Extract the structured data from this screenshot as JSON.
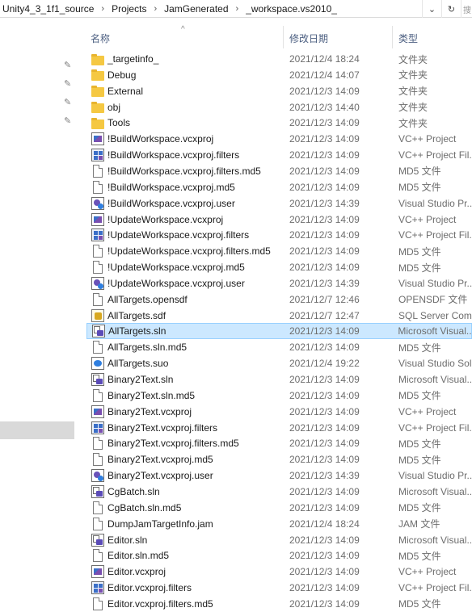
{
  "address": {
    "crumbs": [
      "Unity4_3_1f1_source",
      "Projects",
      "JamGenerated",
      "_workspace.vs2010_"
    ],
    "separator": "›",
    "dropdown_icon": "⌄",
    "refresh_icon": "↻",
    "search_hint": "搜"
  },
  "columns": {
    "name": "名称",
    "date": "修改日期",
    "type": "类型"
  },
  "files": [
    {
      "name": "_targetinfo_",
      "date": "2021/12/4 18:24",
      "type": "文件夹",
      "icon": "folder"
    },
    {
      "name": "Debug",
      "date": "2021/12/4 14:07",
      "type": "文件夹",
      "icon": "folder"
    },
    {
      "name": "External",
      "date": "2021/12/3 14:09",
      "type": "文件夹",
      "icon": "folder"
    },
    {
      "name": "obj",
      "date": "2021/12/3 14:40",
      "type": "文件夹",
      "icon": "folder"
    },
    {
      "name": "Tools",
      "date": "2021/12/3 14:09",
      "type": "文件夹",
      "icon": "folder"
    },
    {
      "name": "!BuildWorkspace.vcxproj",
      "date": "2021/12/3 14:09",
      "type": "VC++ Project",
      "icon": "vcx"
    },
    {
      "name": "!BuildWorkspace.vcxproj.filters",
      "date": "2021/12/3 14:09",
      "type": "VC++ Project Fil...",
      "icon": "vcxf"
    },
    {
      "name": "!BuildWorkspace.vcxproj.filters.md5",
      "date": "2021/12/3 14:09",
      "type": "MD5 文件",
      "icon": "doc"
    },
    {
      "name": "!BuildWorkspace.vcxproj.md5",
      "date": "2021/12/3 14:09",
      "type": "MD5 文件",
      "icon": "doc"
    },
    {
      "name": "!BuildWorkspace.vcxproj.user",
      "date": "2021/12/3 14:39",
      "type": "Visual Studio Pr...",
      "icon": "user"
    },
    {
      "name": "!UpdateWorkspace.vcxproj",
      "date": "2021/12/3 14:09",
      "type": "VC++ Project",
      "icon": "vcx"
    },
    {
      "name": "!UpdateWorkspace.vcxproj.filters",
      "date": "2021/12/3 14:09",
      "type": "VC++ Project Fil...",
      "icon": "vcxf"
    },
    {
      "name": "!UpdateWorkspace.vcxproj.filters.md5",
      "date": "2021/12/3 14:09",
      "type": "MD5 文件",
      "icon": "doc"
    },
    {
      "name": "!UpdateWorkspace.vcxproj.md5",
      "date": "2021/12/3 14:09",
      "type": "MD5 文件",
      "icon": "doc"
    },
    {
      "name": "!UpdateWorkspace.vcxproj.user",
      "date": "2021/12/3 14:39",
      "type": "Visual Studio Pr...",
      "icon": "user"
    },
    {
      "name": "AllTargets.opensdf",
      "date": "2021/12/7 12:46",
      "type": "OPENSDF 文件",
      "icon": "doc"
    },
    {
      "name": "AllTargets.sdf",
      "date": "2021/12/7 12:47",
      "type": "SQL Server Com...",
      "icon": "sdf"
    },
    {
      "name": "AllTargets.sln",
      "date": "2021/12/3 14:09",
      "type": "Microsoft Visual...",
      "icon": "sln",
      "selected": true
    },
    {
      "name": "AllTargets.sln.md5",
      "date": "2021/12/3 14:09",
      "type": "MD5 文件",
      "icon": "doc"
    },
    {
      "name": "AllTargets.suo",
      "date": "2021/12/4 19:22",
      "type": "Visual Studio Sol...",
      "icon": "suo"
    },
    {
      "name": "Binary2Text.sln",
      "date": "2021/12/3 14:09",
      "type": "Microsoft Visual...",
      "icon": "sln"
    },
    {
      "name": "Binary2Text.sln.md5",
      "date": "2021/12/3 14:09",
      "type": "MD5 文件",
      "icon": "doc"
    },
    {
      "name": "Binary2Text.vcxproj",
      "date": "2021/12/3 14:09",
      "type": "VC++ Project",
      "icon": "vcx"
    },
    {
      "name": "Binary2Text.vcxproj.filters",
      "date": "2021/12/3 14:09",
      "type": "VC++ Project Fil...",
      "icon": "vcxf"
    },
    {
      "name": "Binary2Text.vcxproj.filters.md5",
      "date": "2021/12/3 14:09",
      "type": "MD5 文件",
      "icon": "doc"
    },
    {
      "name": "Binary2Text.vcxproj.md5",
      "date": "2021/12/3 14:09",
      "type": "MD5 文件",
      "icon": "doc"
    },
    {
      "name": "Binary2Text.vcxproj.user",
      "date": "2021/12/3 14:39",
      "type": "Visual Studio Pr...",
      "icon": "user"
    },
    {
      "name": "CgBatch.sln",
      "date": "2021/12/3 14:09",
      "type": "Microsoft Visual...",
      "icon": "sln"
    },
    {
      "name": "CgBatch.sln.md5",
      "date": "2021/12/3 14:09",
      "type": "MD5 文件",
      "icon": "doc"
    },
    {
      "name": "DumpJamTargetInfo.jam",
      "date": "2021/12/4 18:24",
      "type": "JAM 文件",
      "icon": "doc"
    },
    {
      "name": "Editor.sln",
      "date": "2021/12/3 14:09",
      "type": "Microsoft Visual...",
      "icon": "sln"
    },
    {
      "name": "Editor.sln.md5",
      "date": "2021/12/3 14:09",
      "type": "MD5 文件",
      "icon": "doc"
    },
    {
      "name": "Editor.vcxproj",
      "date": "2021/12/3 14:09",
      "type": "VC++ Project",
      "icon": "vcx"
    },
    {
      "name": "Editor.vcxproj.filters",
      "date": "2021/12/3 14:09",
      "type": "VC++ Project Fil...",
      "icon": "vcxf"
    },
    {
      "name": "Editor.vcxproj.filters.md5",
      "date": "2021/12/3 14:09",
      "type": "MD5 文件",
      "icon": "doc"
    }
  ]
}
